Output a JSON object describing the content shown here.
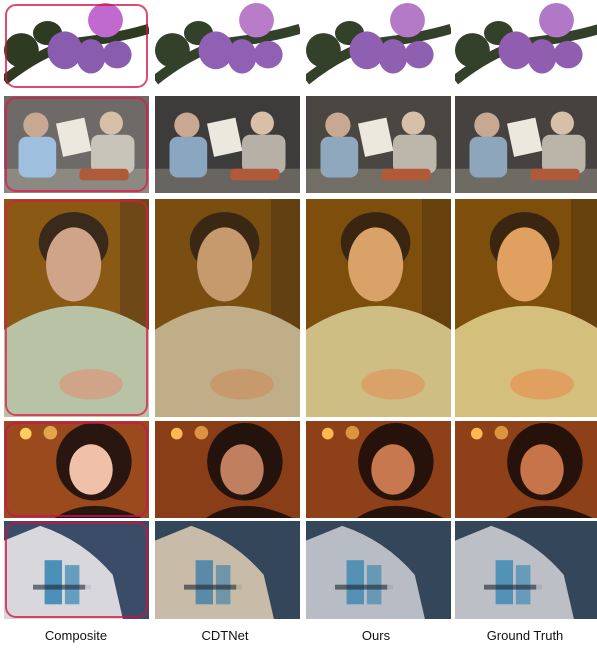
{
  "columns": [
    {
      "label": "Composite",
      "key": "composite"
    },
    {
      "label": "CDTNet",
      "key": "cdtnet"
    },
    {
      "label": "Ours",
      "key": "ours"
    },
    {
      "label": "Ground Truth",
      "key": "gt"
    }
  ],
  "rows": [
    {
      "subject": "hibiscus-flower",
      "tones": {
        "composite": {
          "bg": "#ffffff",
          "main": "#8a5cb0",
          "accent": "#c06ad0",
          "dark": "#2f3a22"
        },
        "cdtnet": {
          "bg": "#ffffff",
          "main": "#9060b4",
          "accent": "#b87cc8",
          "dark": "#33402a"
        },
        "ours": {
          "bg": "#ffffff",
          "main": "#8f5fb2",
          "accent": "#b47ac8",
          "dark": "#33402a"
        },
        "gt": {
          "bg": "#ffffff",
          "main": "#905db0",
          "accent": "#b078c6",
          "dark": "#33402a"
        }
      },
      "outline": "#d01040"
    },
    {
      "subject": "children-reading",
      "tones": {
        "composite": {
          "bg": "#6d6a67",
          "main": "#9fbfde",
          "accent": "#c7c3b8",
          "dark": "#2a2a30"
        },
        "cdtnet": {
          "bg": "#3e3c3a",
          "main": "#8aa6c0",
          "accent": "#b6b0a6",
          "dark": "#1e1e22"
        },
        "ours": {
          "bg": "#4a4743",
          "main": "#8fa8be",
          "accent": "#bdb6aa",
          "dark": "#202024"
        },
        "gt": {
          "bg": "#454240",
          "main": "#8ea6bc",
          "accent": "#bab4a8",
          "dark": "#1f1f23"
        }
      },
      "outline": "#e01848"
    },
    {
      "subject": "woman-portrait",
      "tones": {
        "composite": {
          "bg": "#8a5a14",
          "main": "#cfa488",
          "accent": "#b8c2a4",
          "dark": "#3a2a1c"
        },
        "cdtnet": {
          "bg": "#7a4e10",
          "main": "#c79a6e",
          "accent": "#c0ae88",
          "dark": "#3a2814"
        },
        "ours": {
          "bg": "#7e4f0c",
          "main": "#d8a268",
          "accent": "#cfbe84",
          "dark": "#3a2610"
        },
        "gt": {
          "bg": "#7e4f0c",
          "main": "#e0a060",
          "accent": "#d4c07c",
          "dark": "#3a2610"
        }
      },
      "outline": "#e01848"
    },
    {
      "subject": "smiling-woman",
      "tones": {
        "composite": {
          "bg": "#9a4a1c",
          "main": "#f0c0a8",
          "accent": "#ffcc60",
          "dark": "#2a1610"
        },
        "cdtnet": {
          "bg": "#8a3e18",
          "main": "#c08060",
          "accent": "#ffb850",
          "dark": "#24120c"
        },
        "ours": {
          "bg": "#8e4018",
          "main": "#c8784e",
          "accent": "#ffb850",
          "dark": "#26120a"
        },
        "gt": {
          "bg": "#8e4018",
          "main": "#c8744a",
          "accent": "#ffb850",
          "dark": "#26120a"
        }
      },
      "outline": "#d01058"
    },
    {
      "subject": "modern-building",
      "tones": {
        "composite": {
          "bg": "#3a4c68",
          "main": "#d8d8dc",
          "accent": "#4a90b8",
          "dark": "#1e2634"
        },
        "cdtnet": {
          "bg": "#34465a",
          "main": "#c8bca8",
          "accent": "#5a8aa8",
          "dark": "#1c242e"
        },
        "ours": {
          "bg": "#34465a",
          "main": "#b8bcc4",
          "accent": "#5290b4",
          "dark": "#1c242e"
        },
        "gt": {
          "bg": "#34465a",
          "main": "#bcbfc6",
          "accent": "#5292b6",
          "dark": "#1c242e"
        }
      },
      "outline": "#d01040"
    }
  ]
}
